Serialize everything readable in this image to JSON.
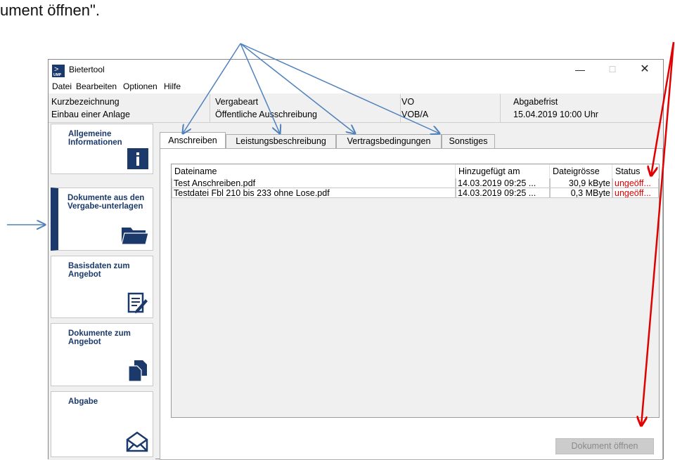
{
  "doc_text": "ument öffnen\".",
  "window": {
    "title": "Bietertool",
    "icon_label": "UMP",
    "controls": {
      "minimize": "—",
      "maximize": "☐",
      "close": "✕"
    }
  },
  "menu": [
    "Datei",
    "Bearbeiten",
    "Optionen",
    "Hilfe"
  ],
  "info": {
    "kurz_label": "Kurzbezeichnung",
    "kurz_value": "Einbau einer Anlage",
    "vergabeart_label": "Vergabeart",
    "vergabeart_value": "Öffentliche Ausschreibung",
    "vo_label": "VO",
    "vo_value": "VOB/A",
    "frist_label": "Abgabefrist",
    "frist_value": "15.04.2019 10:00 Uhr"
  },
  "sidebar": {
    "items": [
      {
        "label": "Allgemeine Informationen",
        "icon": "info-icon",
        "active": false
      },
      {
        "label": "Dokumente aus den Vergabe-unterlagen",
        "icon": "folder-icon",
        "active": true
      },
      {
        "label": "Basisdaten zum Angebot",
        "icon": "edit-document-icon",
        "active": false
      },
      {
        "label": "Dokumente zum Angebot",
        "icon": "documents-icon",
        "active": false
      },
      {
        "label": "Abgabe",
        "icon": "envelope-icon",
        "active": false
      }
    ]
  },
  "tabs": [
    "Anschreiben",
    "Leistungsbeschreibung",
    "Vertragsbedingungen",
    "Sonstiges"
  ],
  "active_tab": "Anschreiben",
  "table": {
    "columns": [
      "Dateiname",
      "Hinzugefügt am",
      "Dateigrösse",
      "Status"
    ],
    "rows": [
      {
        "name": "Test Anschreiben.pdf",
        "added": "14.03.2019 09:25 ...",
        "size": "30,9 kByte",
        "status": "ungeöff..."
      },
      {
        "name": "Testdatei Fbl 210 bis 233 ohne Lose.pdf",
        "added": "14.03.2019 09:25 ...",
        "size": "0,3 MByte",
        "status": "ungeöff..."
      }
    ]
  },
  "buttons": {
    "open": "Dokument öffnen"
  },
  "colors": {
    "nav_blue": "#1b3a6b",
    "annotation_blue": "#4f81bd",
    "annotation_red": "#e00000",
    "status_red": "#e00000"
  }
}
